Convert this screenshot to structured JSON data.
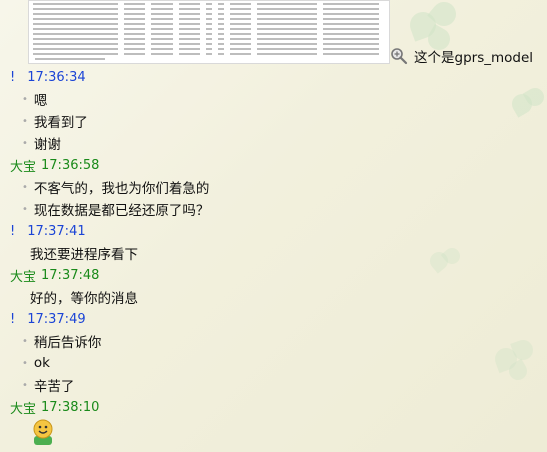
{
  "thumbnail": {
    "caption": "这个是gprs_model",
    "zoom_icon": "magnifier-zoom-icon"
  },
  "messages": [
    {
      "sender": "!",
      "sender_color": "#1b44d6",
      "time": "17:36:34",
      "lines": [
        "嗯",
        "我看到了",
        "谢谢"
      ],
      "bullets": true
    },
    {
      "sender": "大宝",
      "sender_color": "#1a8a1a",
      "time": "17:36:58",
      "lines": [
        "不客气的，我也为你们着急的",
        "现在数据是都已经还原了吗？"
      ],
      "bullets": true
    },
    {
      "sender": "!",
      "sender_color": "#1b44d6",
      "time": "17:37:41",
      "lines": [
        "我还要进程序看下"
      ],
      "bullets": false
    },
    {
      "sender": "大宝",
      "sender_color": "#1a8a1a",
      "time": "17:37:48",
      "lines": [
        "好的，等你的消息"
      ],
      "bullets": false
    },
    {
      "sender": "!",
      "sender_color": "#1b44d6",
      "time": "17:37:49",
      "lines": [
        "稍后告诉你",
        "ok",
        "辛苦了"
      ],
      "bullets": true
    },
    {
      "sender": "大宝",
      "sender_color": "#1a8a1a",
      "time": "17:38:10",
      "lines": [],
      "emoji": "smiley-emoji-icon"
    }
  ]
}
